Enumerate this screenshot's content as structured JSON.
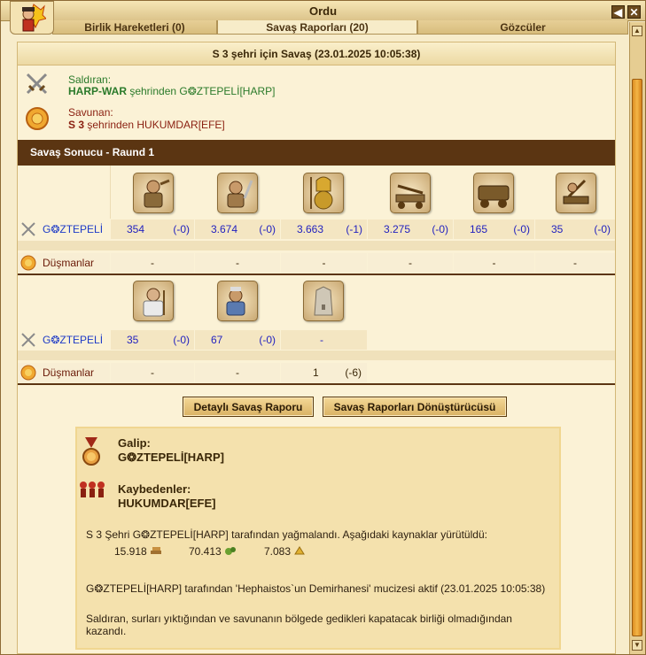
{
  "window": {
    "title": "Ordu"
  },
  "tabs": [
    {
      "label": "Birlik Hareketleri (0)"
    },
    {
      "label": "Savaş Raporları (20)"
    },
    {
      "label": "Gözcüler"
    }
  ],
  "report": {
    "header": "S 3 şehri için Savaş (23.01.2025 10:05:38)",
    "attacker_label": "Saldıran:",
    "attacker_city": "HARP-WAR",
    "attacker_mid": " şehrinden ",
    "attacker_player": "G❂ZTEPELİ[HARP]",
    "defender_label": "Savunan:",
    "defender_city": "S 3",
    "defender_mid": " şehrinden ",
    "defender_player": "HUKUMDAR[EFE]",
    "result_title": "Savaş Sonucu - Raund 1"
  },
  "units_row1": {
    "player": "G❂ZTEPELİ",
    "enemy_label": "Düşmanlar",
    "units": [
      {
        "icon": "slinger-unit-icon",
        "value": "354",
        "delta": "(-0)",
        "enemy": "-"
      },
      {
        "icon": "swordsman-unit-icon",
        "value": "3.674",
        "delta": "(-0)",
        "enemy": "-"
      },
      {
        "icon": "hoplite-unit-icon",
        "value": "3.663",
        "delta": "(-1)",
        "enemy": "-"
      },
      {
        "icon": "ballista-unit-icon",
        "value": "3.275",
        "delta": "(-0)",
        "enemy": "-"
      },
      {
        "icon": "ram-unit-icon",
        "value": "165",
        "delta": "(-0)",
        "enemy": "-"
      },
      {
        "icon": "catapult-unit-icon",
        "value": "35",
        "delta": "(-0)",
        "enemy": "-"
      }
    ]
  },
  "units_row2": {
    "player": "G❂ZTEPELİ",
    "enemy_label": "Düşmanlar",
    "units": [
      {
        "icon": "doctor-unit-icon",
        "value": "35",
        "delta": "(-0)",
        "enemy": "-"
      },
      {
        "icon": "cook-unit-icon",
        "value": "67",
        "delta": "(-0)",
        "enemy": "-"
      },
      {
        "icon": "wall-icon",
        "value": "-",
        "delta": "",
        "enemy": "1",
        "enemy_delta": "(-6)"
      }
    ]
  },
  "buttons": {
    "detailed": "Detaylı Savaş Raporu",
    "converter": "Savaş Raporları Dönüştürücüsü"
  },
  "summary": {
    "winner_label": "Galip:",
    "winner": "G❂ZTEPELİ[HARP]",
    "losers_label": "Kaybedenler:",
    "losers": "HUKUMDAR[EFE]",
    "plunder_text": "S 3 Şehri G❂ZTEPELİ[HARP] tarafından yağmalandı. Aşağıdaki kaynaklar yürütüldü:",
    "resources": [
      {
        "value": "15.918",
        "icon": "wood-icon"
      },
      {
        "value": "70.413",
        "icon": "food-icon"
      },
      {
        "value": "7.083",
        "icon": "gold-icon"
      }
    ],
    "miracle_text": "G❂ZTEPELİ[HARP] tarafından 'Hephaistos`un Demirhanesi' mucizesi aktif (23.01.2025 10:05:38)",
    "conclusion_line1": "Saldıran, surları yıktığından ve savunanın bölgede gedikleri kapatacak birliği olmadığından",
    "conclusion_line2": "kazandı."
  },
  "colors": {
    "bar_dark": "#5b3512",
    "attacker_green": "#2a7a2a",
    "defender_red": "#8a1f10",
    "value_blue": "#1f1fbf",
    "scroll_orange": "#f4b546"
  }
}
